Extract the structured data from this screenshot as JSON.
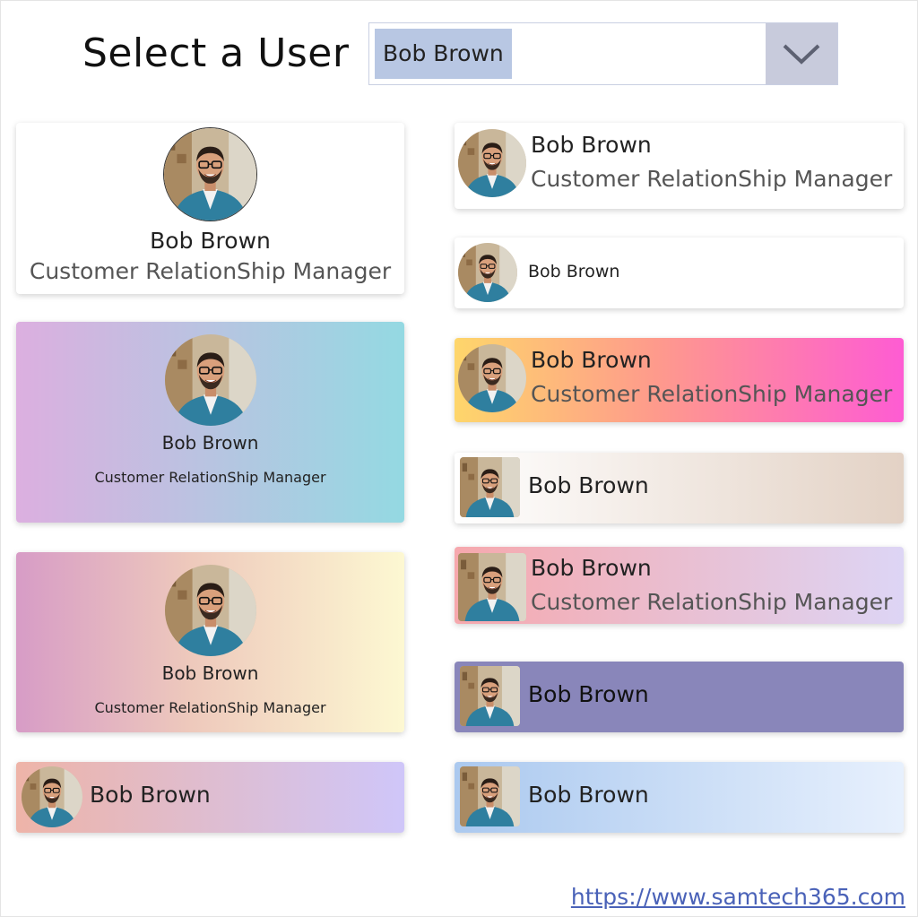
{
  "header": {
    "title": "Select a User"
  },
  "dropdown": {
    "selected": "Bob Brown",
    "chevron_icon": "chevron-down-icon"
  },
  "cards": [
    {
      "id": "card-1",
      "name": "Bob Brown",
      "role": "Customer RelationShip Manager",
      "background": "#ffffff"
    },
    {
      "id": "card-2",
      "name": "Bob Brown",
      "role": "Customer RelationShip Manager",
      "background": [
        "#dcafe0",
        "#94d9e2"
      ]
    },
    {
      "id": "card-3",
      "name": "Bob Brown",
      "role": "Customer RelationShip Manager",
      "background": [
        "#d79cc6",
        "#fdf8d2"
      ]
    },
    {
      "id": "card-4",
      "name": "Bob Brown",
      "background": [
        "#eeb4a8",
        "#cfc6f9"
      ]
    },
    {
      "id": "card-5",
      "name": "Bob Brown",
      "role": "Customer RelationShip Manager",
      "background": "#ffffff"
    },
    {
      "id": "card-6",
      "name": "Bob Brown",
      "background": "#ffffff"
    },
    {
      "id": "card-7",
      "name": "Bob Brown",
      "role": "Customer RelationShip Manager",
      "background": [
        "#fed66b",
        "#fe9a8c",
        "#fe5cd3"
      ]
    },
    {
      "id": "card-8",
      "name": "Bob Brown",
      "background": [
        "#ffffff",
        "#e3d2c5"
      ]
    },
    {
      "id": "card-9",
      "name": "Bob Brown",
      "role": "Customer RelationShip Manager",
      "background": [
        "#f6a8ad",
        "#ddd5f5"
      ]
    },
    {
      "id": "card-10",
      "name": "Bob Brown",
      "background": "#8986ba"
    },
    {
      "id": "card-11",
      "name": "Bob Brown",
      "background": [
        "#abc9ef",
        "#e7f0fd"
      ]
    }
  ],
  "footer": {
    "link": "https://www.samtech365.com"
  },
  "colors": {
    "select_highlight": "#b8c7e3",
    "chevron_bg": "#c8cbdc",
    "link": "#4a62b8"
  }
}
